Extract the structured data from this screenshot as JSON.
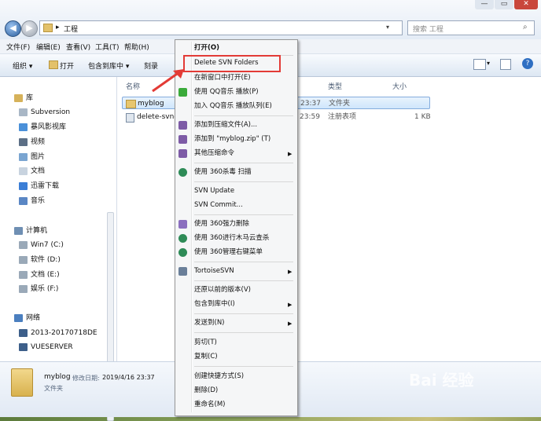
{
  "address": {
    "path": "工程",
    "arrow": "▸"
  },
  "search": {
    "placeholder": "搜索 工程"
  },
  "menubar": [
    "文件(F)",
    "编辑(E)",
    "查看(V)",
    "工具(T)",
    "帮助(H)"
  ],
  "toolbar": {
    "organize": "组织 ▾",
    "open": "打开",
    "include": "包含到库中 ▾",
    "burn": "刻录"
  },
  "nav": {
    "library": "库",
    "library_items": [
      "Subversion",
      "暴风影视库",
      "视频",
      "图片",
      "文档",
      "迅雷下载",
      "音乐"
    ],
    "computer": "计算机",
    "drives": [
      "Win7 (C:)",
      "软件 (D:)",
      "文档 (E:)",
      "娱乐 (F:)"
    ],
    "network": "网络",
    "network_items": [
      "2013-20170718DE",
      "VUESERVER"
    ]
  },
  "columns": {
    "name": "名称",
    "type": "类型",
    "size": "大小"
  },
  "files": [
    {
      "name": "myblog",
      "time": "23:37",
      "type": "文件夹",
      "size": ""
    },
    {
      "name": "delete-svn-n",
      "time": "23:59",
      "type": "注册表项",
      "size": "1 KB"
    }
  ],
  "details": {
    "name": "myblog",
    "modified_label": "修改日期:",
    "modified": "2019/4/16 23:37",
    "type": "文件夹"
  },
  "context_menu": [
    {
      "label": "打开(O)",
      "bold": true
    },
    {
      "label": "Delete SVN Folders",
      "highlighted": true
    },
    {
      "label": "在新窗口中打开(E)"
    },
    {
      "label": "使用 QQ音乐 播放(P)"
    },
    {
      "label": "加入 QQ音乐 播放队列(E)"
    },
    {
      "label": "添加到压缩文件(A)..."
    },
    {
      "label": "添加到 \"myblog.zip\" (T)"
    },
    {
      "label": "其他压缩命令",
      "submenu": true
    },
    {
      "label": "使用 360杀毒 扫描"
    },
    {
      "label": "SVN Update"
    },
    {
      "label": "SVN Commit..."
    },
    {
      "label": "使用 360强力删除"
    },
    {
      "label": "使用 360进行木马云查杀"
    },
    {
      "label": "使用 360管理右键菜单"
    },
    {
      "label": "TortoiseSVN",
      "submenu": true
    },
    {
      "label": "还原以前的版本(V)"
    },
    {
      "label": "包含到库中(I)",
      "submenu": true
    },
    {
      "label": "发送到(N)",
      "submenu": true
    },
    {
      "label": "剪切(T)"
    },
    {
      "label": "复制(C)"
    },
    {
      "label": "创建快捷方式(S)"
    },
    {
      "label": "删除(D)"
    },
    {
      "label": "重命名(M)"
    }
  ],
  "watermark": "Bai 经验",
  "colors": {
    "highlight": "#e33b36",
    "selection": "#cfe6fb"
  }
}
